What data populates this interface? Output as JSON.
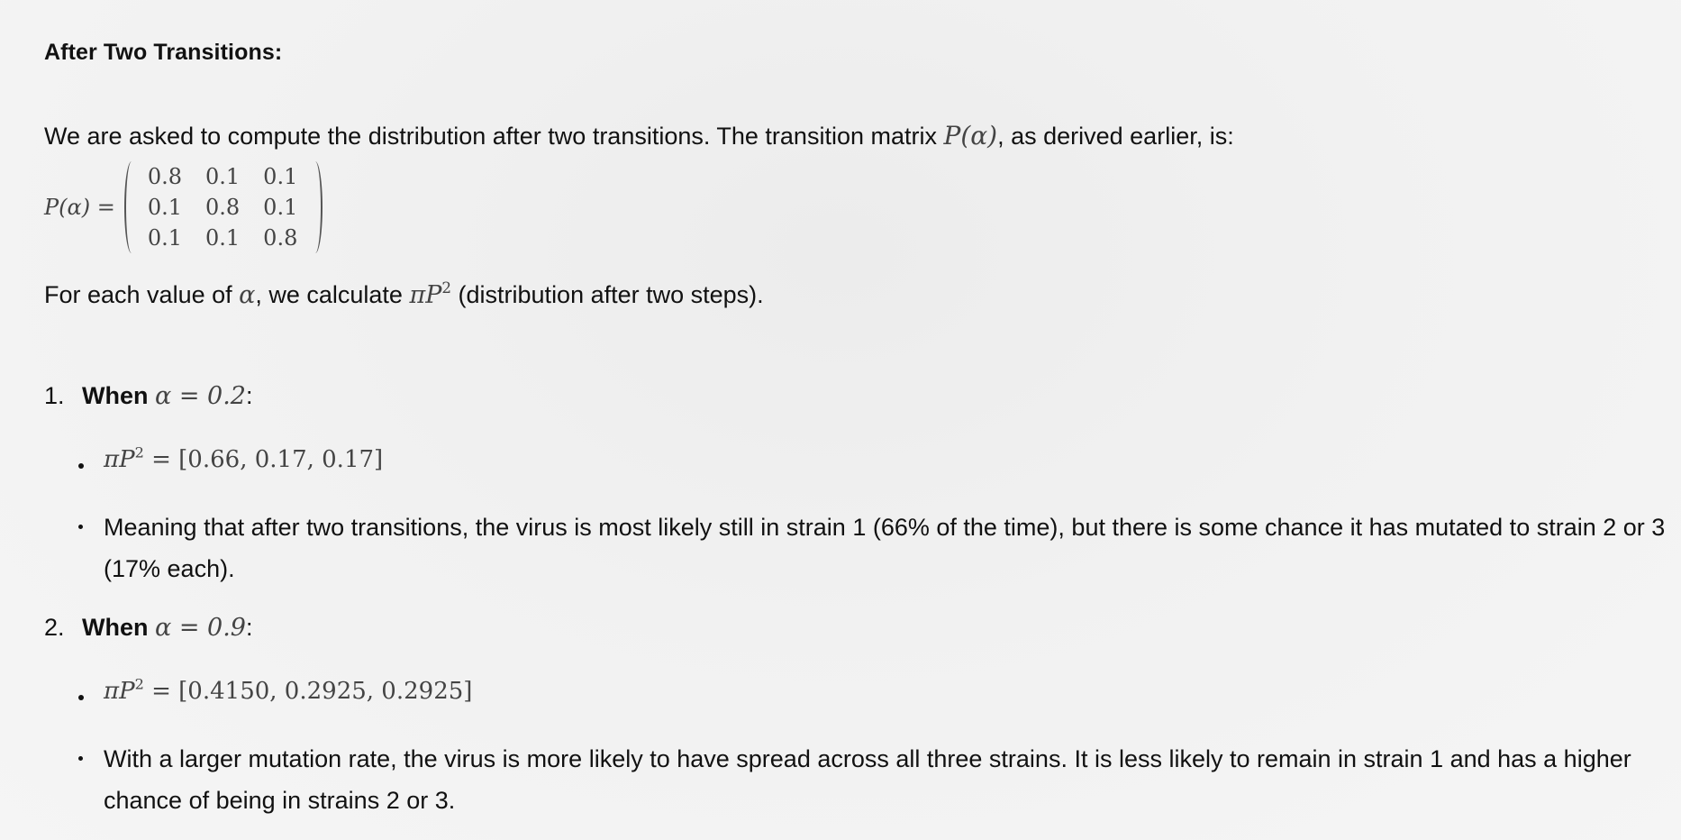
{
  "heading": "After Two Transitions:",
  "intro": {
    "text_before": "We are asked to compute the distribution after two transitions. The transition matrix ",
    "math": "P(α)",
    "text_after": ", as derived earlier, is:"
  },
  "matrix": {
    "lhs": "P(α) =",
    "rows": [
      [
        "0.8",
        "0.1",
        "0.1"
      ],
      [
        "0.1",
        "0.8",
        "0.1"
      ],
      [
        "0.1",
        "0.1",
        "0.8"
      ]
    ]
  },
  "step_line": {
    "text_before": "For each value of ",
    "alpha": "α",
    "text_mid": ", we calculate ",
    "pi": "π",
    "P": "P",
    "exp": "2",
    "text_after": " (distribution after two steps)."
  },
  "cases": [
    {
      "number": "1.",
      "label": "When",
      "condition": "α = 0.2",
      "colon": ":",
      "result_lhs_pi": "π",
      "result_lhs_P": "P",
      "result_exp": "2",
      "result_rhs": " = [0.66, 0.17, 0.17]",
      "explanation": "Meaning that after two transitions, the virus is most likely still in strain 1 (66% of the time), but there is some chance it has mutated to strain 2 or 3 (17% each)."
    },
    {
      "number": "2.",
      "label": "When",
      "condition": "α = 0.9",
      "colon": ":",
      "result_lhs_pi": "π",
      "result_lhs_P": "P",
      "result_exp": "2",
      "result_rhs": " = [0.4150, 0.2925, 0.2925]",
      "explanation": "With a larger mutation rate, the virus is more likely to have spread across all three strains. It is less likely to remain in strain 1 and has a higher chance of being in strains 2 or 3."
    }
  ]
}
